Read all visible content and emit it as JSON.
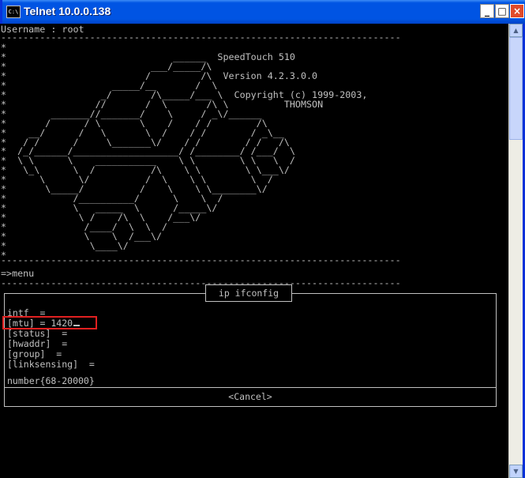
{
  "window": {
    "title": "Telnet 10.0.0.138",
    "icon_label": "C:\\",
    "controls": [
      "minimize-icon",
      "maximize-icon",
      "close-icon"
    ]
  },
  "terminal": {
    "username_line": "Username : root",
    "banner": [
      "*",
      "*                              ______  SpeedTouch 510",
      "*                          ___/_____/\\",
      "*                         /         /\\  Version 4.2.3.0.0",
      "*                   _____/__       /  \\",
      "*                 _/       /\\_____/___ \\  Copyright (c) 1999-2003,",
      "*                //       /  \\       /\\ \\          THOMSON",
      "*        _______//_______/    \\     / _\\/______",
      "*       /      / \\       \\    /    / /        /\\",
      "*    __/      /   \\       \\  /    / /        / _\\__",
      "*   / /      /     \\_______\\/    / /        / /   /\\",
      "*  /_/______/___________________/ /________/ /___/  \\",
      "*  \\ \\      \\    ___________    \\ \\        \\ \\   \\  /",
      "*   \\_\\      \\  /          /\\    \\ \\        \\ \\___\\/",
      "*      \\      \\/          /  \\    \\ \\        \\  /",
      "*       \\_____/          /    \\    \\ \\________\\/",
      "*            /__________/      \\    \\  /",
      "*            \\   _____  \\      /_____\\/",
      "*             \\ /    /\\  \\    /___\\/",
      "*              /____/  \\  \\  /",
      "*              \\    \\  /___\\/",
      "*               \\____\\/",
      "*"
    ],
    "prompt_line": "=>menu"
  },
  "dialog": {
    "title": "ip ifconfig",
    "fields": [
      {
        "label": "intf",
        "value": "intf  ="
      },
      {
        "label": "mtu",
        "value": "[mtu] = 1420"
      },
      {
        "label": "status",
        "value": "[status]  ="
      },
      {
        "label": "hwaddr",
        "value": "[hwaddr]  ="
      },
      {
        "label": "group",
        "value": "[group]  ="
      },
      {
        "label": "linksensing",
        "value": "[linksensing]  ="
      }
    ],
    "hint": "number{68-20000}",
    "cancel_label": "<Cancel>"
  },
  "colors": {
    "titlebar": "#0054E3",
    "terminal_bg": "#000000",
    "terminal_fg": "#C0C0C0",
    "highlight": "#E02020"
  }
}
